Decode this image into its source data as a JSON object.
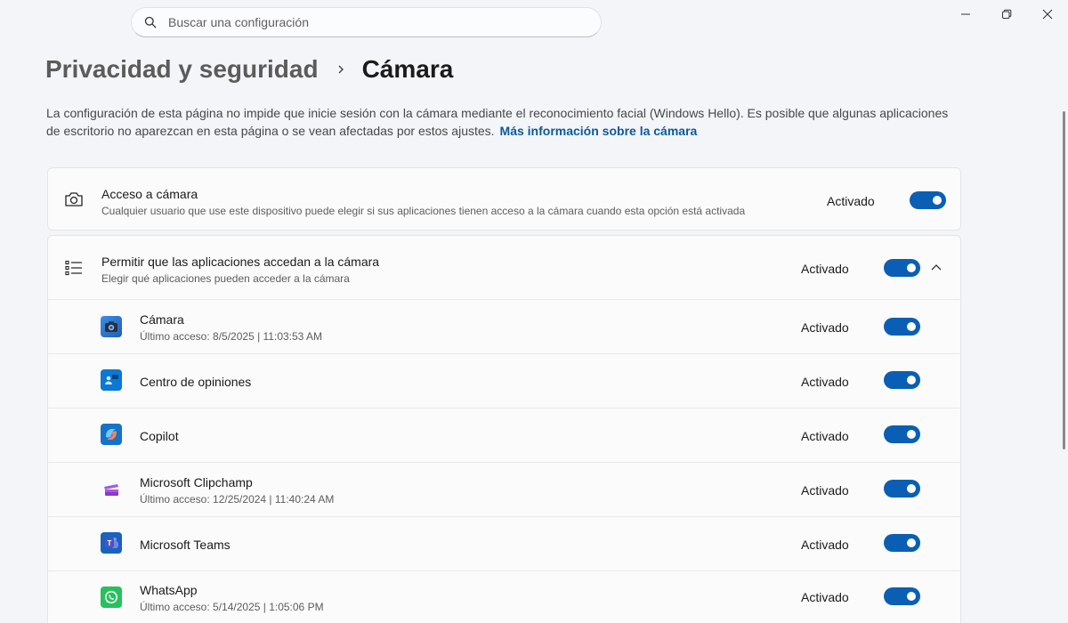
{
  "search": {
    "placeholder": "Buscar una configuración"
  },
  "breadcrumb": {
    "parent": "Privacidad y seguridad",
    "current": "Cámara"
  },
  "description": {
    "text": "La configuración de esta página no impide que inicie sesión con la cámara mediante el reconocimiento facial (Windows Hello). Es posible que algunas aplicaciones de escritorio no aparezcan en esta página o se vean afectadas por estos ajustes.",
    "link": "Más información sobre la cámara"
  },
  "camera_access": {
    "title": "Acceso a cámara",
    "subtitle": "Cualquier usuario que use este dispositivo puede elegir si sus aplicaciones tienen acceso a la cámara cuando esta opción está activada",
    "state": "Activado",
    "icon": "camera-icon"
  },
  "app_access": {
    "title": "Permitir que las aplicaciones accedan a la cámara",
    "subtitle": "Elegir qué aplicaciones pueden acceder a la cámara",
    "state": "Activado",
    "icon": "app-list-icon"
  },
  "apps": [
    {
      "name": "Cámara",
      "last_access": "Último acceso: 8/5/2025  |  11:03:53 AM",
      "state": "Activado",
      "icon": "camera-app-icon",
      "color": "#2b6fc2"
    },
    {
      "name": "Centro de opiniones",
      "last_access": "",
      "state": "Activado",
      "icon": "feedback-hub-icon",
      "color": "#0a78d4"
    },
    {
      "name": "Copilot",
      "last_access": "",
      "state": "Activado",
      "icon": "copilot-icon",
      "color": "#1572c9"
    },
    {
      "name": "Microsoft Clipchamp",
      "last_access": "Último acceso: 12/25/2024  |  11:40:24 AM",
      "state": "Activado",
      "icon": "clipchamp-icon",
      "color": "#7a3fd4"
    },
    {
      "name": "Microsoft Teams",
      "last_access": "",
      "state": "Activado",
      "icon": "teams-icon",
      "color": "#1a62c0"
    },
    {
      "name": "WhatsApp",
      "last_access": "Último acceso: 5/14/2025  |  1:05:06 PM",
      "state": "Activado",
      "icon": "whatsapp-icon",
      "color": "#25c15d"
    }
  ],
  "colors": {
    "accent": "#0a5fb4",
    "link": "#0a5a9c",
    "background": "#f3f5f9"
  }
}
